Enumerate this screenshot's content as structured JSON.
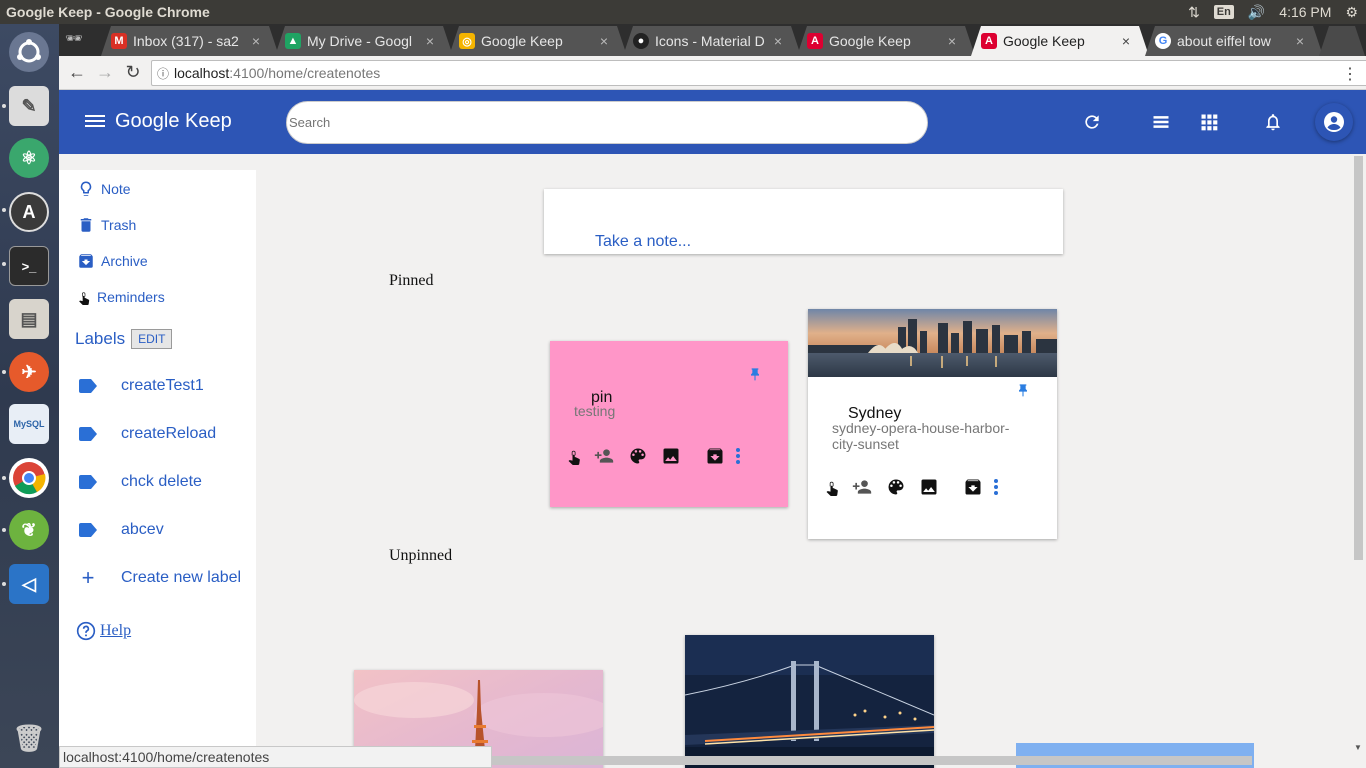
{
  "os": {
    "window_title": "Google Keep - Google Chrome",
    "lang": "En",
    "time": "4:16 PM"
  },
  "browser": {
    "tabs": [
      {
        "title": "Inbox (317) - sa2",
        "favicon": "gmail-icon",
        "color": "#d93025",
        "active": false
      },
      {
        "title": "My Drive - Googl",
        "favicon": "drive-icon",
        "color": "#1fa463",
        "active": false
      },
      {
        "title": "Google Keep",
        "favicon": "keep-icon",
        "color": "#f4b400",
        "active": false
      },
      {
        "title": "Icons - Material D",
        "favicon": "github-icon",
        "color": "#222222",
        "active": false
      },
      {
        "title": "Google Keep",
        "favicon": "angular-icon",
        "color": "#dd0031",
        "active": false
      },
      {
        "title": "Google Keep",
        "favicon": "angular-icon",
        "color": "#dd0031",
        "active": true
      },
      {
        "title": "about eiffel tow",
        "favicon": "google-icon",
        "color": "#4285f4",
        "active": false
      }
    ],
    "url_host": "localhost",
    "url_path": ":4100/home/createnotes",
    "status_text": "localhost:4100/home/createnotes"
  },
  "app": {
    "title": "Google Keep",
    "search_placeholder": "Search",
    "header_color": "#2d55b5"
  },
  "sidebar": {
    "items": [
      {
        "label": "Note",
        "icon": "lightbulb-icon"
      },
      {
        "label": "Trash",
        "icon": "trash-icon"
      },
      {
        "label": "Archive",
        "icon": "archive-icon"
      },
      {
        "label": "Reminders",
        "icon": "touch-icon"
      }
    ],
    "labels_heading": "Labels",
    "edit_label": "EDIT",
    "labels": [
      "createTest1",
      "createReload",
      "chck delete",
      "abcev"
    ],
    "create_label": "Create new label",
    "help": "Help"
  },
  "main": {
    "take_note": "Take a note...",
    "pinned_heading": "Pinned",
    "unpinned_heading": "Unpinned",
    "pinned_notes": [
      {
        "title": "pin",
        "body": "testing",
        "color": "#ff96c8"
      },
      {
        "title": "Sydney",
        "body": "sydney-opera-house-harbor-city-sunset",
        "color": "#ffffff",
        "image": "sydney-skyline"
      }
    ],
    "unpinned_notes": [
      {
        "image": "eiffel-tower"
      },
      {
        "image": "george-washington-bridge"
      }
    ]
  }
}
